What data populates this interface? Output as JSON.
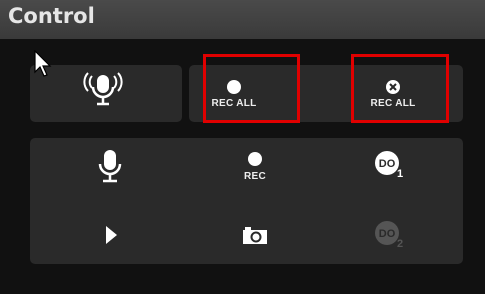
{
  "panel": {
    "title": "Control"
  },
  "buttons": {
    "record_all": {
      "label": "REC ALL",
      "icon": "record-dot-icon"
    },
    "cancel_record_all": {
      "label": "REC ALL",
      "icon": "circle-x-icon"
    },
    "record": {
      "label": "REC",
      "icon": "record-dot-icon"
    },
    "broadcast_mic": {
      "icon": "broadcast-mic-icon"
    },
    "microphone": {
      "icon": "microphone-icon"
    },
    "play": {
      "icon": "play-icon"
    },
    "snapshot": {
      "icon": "camera-icon"
    },
    "do1": {
      "icon": "do-1-icon"
    },
    "do2": {
      "icon": "do-2-icon",
      "state": "disabled"
    }
  },
  "colors": {
    "header": "#444444",
    "background": "#000000",
    "button_box": "#2a2a2a",
    "highlight": "#e00000",
    "icon": "#ffffff",
    "icon_disabled": "#555555"
  }
}
